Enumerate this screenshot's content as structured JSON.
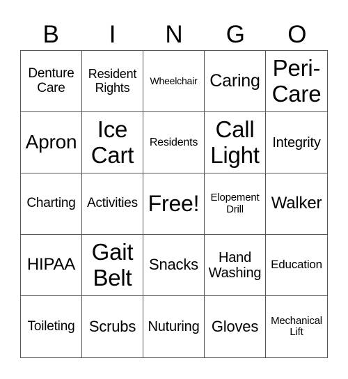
{
  "header": [
    "B",
    "I",
    "N",
    "G",
    "O"
  ],
  "cells": [
    "Denture\nCare",
    "Resident\nRights",
    "Wheelchair",
    "Caring",
    "Peri-\nCare",
    "Apron",
    "Ice\nCart",
    "Residents",
    "Call\nLight",
    "Integrity",
    "Charting",
    "Activities",
    "Free!",
    "Elopement\nDrill",
    "Walker",
    "HIPAA",
    "Gait\nBelt",
    "Snacks",
    "Hand\nWashing",
    "Education",
    "Toileting",
    "Scrubs",
    "Nuturing",
    "Gloves",
    "Mechanical\nLift"
  ]
}
